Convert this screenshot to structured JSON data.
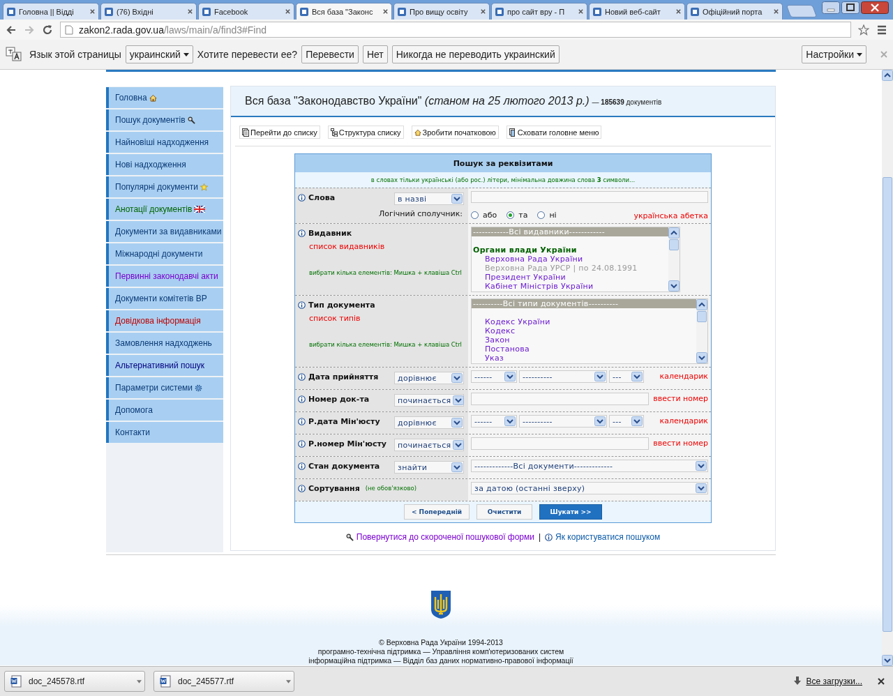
{
  "browser_tabs": [
    {
      "title": "Головна || Відді",
      "selected": false
    },
    {
      "title": "(76) Вхідні",
      "selected": false
    },
    {
      "title": "Facebook",
      "selected": false
    },
    {
      "title": "Вся база \"Законс",
      "selected": true
    },
    {
      "title": "Про вищу освіту",
      "selected": false
    },
    {
      "title": "про сайт вру - П",
      "selected": false
    },
    {
      "title": "Новий веб-сайт",
      "selected": false
    },
    {
      "title": "Офіційний порта",
      "selected": false
    }
  ],
  "address_bar": {
    "host": "zakon2.rada.gov.ua",
    "path": "/laws/main/a/find3#Find"
  },
  "translate_bar": {
    "language_label": "Язык этой страницы",
    "language": "украинский",
    "question": "Хотите перевести ее?",
    "buttons": [
      "Перевести",
      "Нет",
      "Никогда не переводить украинский"
    ],
    "settings": "Настройки"
  },
  "sidebar": {
    "items": [
      {
        "label": "Головна",
        "kind": "home"
      },
      {
        "label": "Пошук документів",
        "kind": "search"
      },
      {
        "label": "Найновіші надходження",
        "kind": "plain"
      },
      {
        "label": "Нові надходження",
        "kind": "plain"
      },
      {
        "label": "Популярні документи",
        "kind": "star"
      },
      {
        "label": "Анотації документів",
        "kind": "annotations"
      },
      {
        "label": "Документи за видавниками",
        "kind": "plain"
      },
      {
        "label": "Міжнародні документи",
        "kind": "plain"
      },
      {
        "label": "Первинні законодавчі акти",
        "kind": "primary"
      },
      {
        "label": "Документи комітетів ВР",
        "kind": "plain"
      },
      {
        "label": "Довідкова інформація",
        "kind": "reference"
      },
      {
        "label": "Замовлення надходжень",
        "kind": "plain"
      },
      {
        "label": "Альтернативний пошук",
        "kind": "alternative"
      },
      {
        "label": "Параметри системи",
        "kind": "gear"
      },
      {
        "label": "Допомога",
        "kind": "plain"
      },
      {
        "label": "Контакти",
        "kind": "plain"
      }
    ]
  },
  "header": {
    "title": "Вся база \"Законодавство України\" *(станом на 25 лютого 2013 р.)*",
    "count": "— **185639** документів"
  },
  "toolbar": [
    "Перейти до списку",
    "Структура списку",
    "Зробити початковою",
    "Сховати головне меню"
  ],
  "form": {
    "title": "Пошук за реквізитами",
    "hint": "в словах тільки українські (або рос.) літери, мінімальна довжина слова **3** символи...",
    "rows": [
      {
        "kind": "words",
        "label": "Слова",
        "operator": "в назві",
        "connective_label": "Логічний сполучник:",
        "connectives": [
          {
            "label": "або",
            "selected": false
          },
          {
            "label": "та",
            "selected": true
          },
          {
            "label": "ні",
            "selected": false
          }
        ],
        "link": "українська абетка"
      },
      {
        "kind": "list",
        "label": "Видавник",
        "link": "список видавників",
        "hint": "вибрати кілька елементів: Мишка + клавіша Ctrl",
        "options": [
          {
            "text": "------------Всі видавники------------",
            "kind": "option",
            "selected": true,
            "disabled": false
          },
          {
            "text": "Органи влади України",
            "kind": "group",
            "selected": false,
            "disabled": false
          },
          {
            "text": "Верховна Рада України",
            "kind": "option",
            "selected": false,
            "disabled": false
          },
          {
            "text": "Верховна Рада УРСР | по 24.08.1991",
            "kind": "option",
            "selected": false,
            "disabled": true
          },
          {
            "text": "Президент України",
            "kind": "option",
            "selected": false,
            "disabled": false
          },
          {
            "text": "Кабінет Міністрів України",
            "kind": "option",
            "selected": false,
            "disabled": false
          }
        ]
      },
      {
        "kind": "list",
        "label": "Тип документа",
        "link": "список типів",
        "hint": "вибрати кілька елементів: Мишка + клавіша Ctrl",
        "options": [
          {
            "text": "----------Всі типи документів----------",
            "kind": "option",
            "selected": true,
            "disabled": false
          },
          {
            "text": "Кодекс України",
            "kind": "option",
            "selected": false,
            "disabled": false
          },
          {
            "text": "Кодекс",
            "kind": "option",
            "selected": false,
            "disabled": false
          },
          {
            "text": "Закон",
            "kind": "option",
            "selected": false,
            "disabled": false
          },
          {
            "text": "Постанова",
            "kind": "option",
            "selected": false,
            "disabled": false
          },
          {
            "text": "Указ",
            "kind": "option",
            "selected": false,
            "disabled": false
          }
        ]
      },
      {
        "kind": "date",
        "label": "Дата прийняття",
        "operator": "дорівнює",
        "selects": [
          "------",
          "----------",
          "---"
        ],
        "link": "календарик"
      },
      {
        "kind": "number",
        "label": "Номер док-та",
        "operator": "починається",
        "link": "ввести номер"
      },
      {
        "kind": "date",
        "label": "Р.дата Мін'юсту",
        "operator": "дорівнює",
        "selects": [
          "------",
          "----------",
          "---"
        ],
        "link": "календарик"
      },
      {
        "kind": "number",
        "label": "Р.номер Мін'юсту",
        "operator": "починається",
        "link": "ввести номер"
      },
      {
        "kind": "select",
        "label": "Стан документа",
        "operator": "знайти",
        "value": "-------------Всі документи-------------"
      },
      {
        "kind": "select",
        "label": "Сортування",
        "note": "(не обов'язково)",
        "value": "за датою (останні зверху)"
      }
    ],
    "buttons": [
      {
        "label": "< Попередній",
        "primary": false
      },
      {
        "label": "Очистити",
        "primary": false
      },
      {
        "label": "Шукати >>",
        "primary": true
      }
    ]
  },
  "bottom_links": {
    "items": [
      {
        "text": "Повернутися до скороченої пошукової форми",
        "visited": true
      },
      {
        "text": "Як користуватися пошуком",
        "visited": false
      }
    ],
    "separator": "|"
  },
  "footer": [
    "© Верховна Рада України 1994-2013",
    "програмно-технічна підтримка — Управління комп'ютеризованих систем",
    "інформаційна підтримка — Відділ баз даних нормативно-правової інформації"
  ],
  "downloads": {
    "files": [
      "doc_245578.rtf",
      "doc_245577.rtf"
    ],
    "all_link": "Все загрузки..."
  }
}
